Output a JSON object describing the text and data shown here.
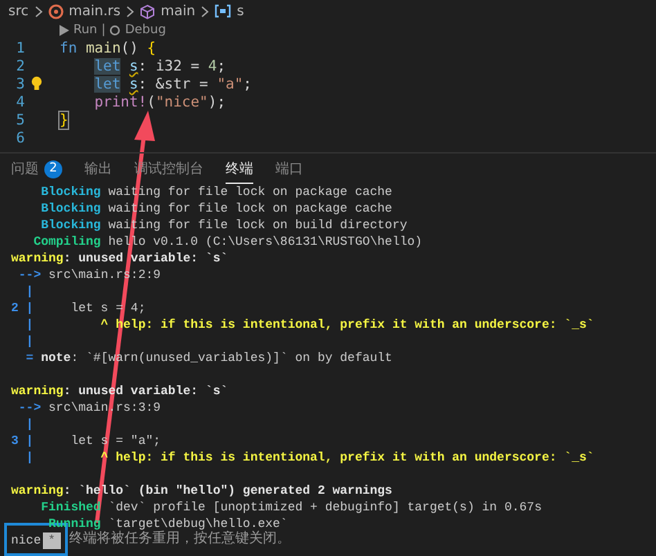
{
  "breadcrumb": [
    {
      "text": "src",
      "kind": "folder"
    },
    {
      "text": "main.rs",
      "kind": "file"
    },
    {
      "text": "main",
      "kind": "function"
    },
    {
      "text": "s",
      "kind": "variable"
    }
  ],
  "codelens": [
    {
      "text": "Run",
      "kind": "run"
    },
    {
      "text": "|",
      "kind": "separator"
    },
    {
      "text": "Debug",
      "kind": "debug"
    }
  ],
  "editor": {
    "lines": [
      {
        "number": "1",
        "tokens": [
          {
            "text": "fn",
            "kind": "keyword"
          },
          {
            "text": " main",
            "kind": "function"
          },
          {
            "text": "() ",
            "kind": "plain"
          },
          {
            "text": "{",
            "kind": "bracket"
          }
        ]
      },
      {
        "number": "2",
        "tokens": [
          {
            "kind": "indent"
          },
          {
            "text": "let",
            "kind": "keyword-match"
          },
          {
            "text": "s",
            "kind": "variable-warn"
          },
          {
            "text": ": ",
            "kind": "plain"
          },
          {
            "text": "i32",
            "kind": "type"
          },
          {
            "text": " = ",
            "kind": "plain"
          },
          {
            "text": "4",
            "kind": "number"
          },
          {
            "text": ";",
            "kind": "plain"
          }
        ]
      },
      {
        "number": "3",
        "lightbulb": true,
        "tokens": [
          {
            "kind": "indent"
          },
          {
            "text": "let",
            "kind": "keyword-match"
          },
          {
            "text": "s",
            "kind": "variable-warn"
          },
          {
            "text": ": &",
            "kind": "plain"
          },
          {
            "text": "str",
            "kind": "type"
          },
          {
            "text": " = ",
            "kind": "plain"
          },
          {
            "text": "\"a\"",
            "kind": "string"
          },
          {
            "text": ";",
            "kind": "plain"
          }
        ]
      },
      {
        "number": "4",
        "tokens": [
          {
            "kind": "indent"
          },
          {
            "text": "print!",
            "kind": "macro"
          },
          {
            "text": "(",
            "kind": "plain"
          },
          {
            "text": "\"nice\"",
            "kind": "string"
          },
          {
            "text": ");",
            "kind": "plain"
          }
        ]
      },
      {
        "number": "5",
        "tokens": [
          {
            "text": "}",
            "kind": "bracket-match"
          }
        ]
      },
      {
        "number": "6"
      }
    ]
  },
  "panel_tabs": [
    {
      "label": "问题",
      "badge": "2",
      "selected": false
    },
    {
      "label": "输出",
      "selected": false
    },
    {
      "label": "调试控制台",
      "selected": false
    },
    {
      "label": "终端",
      "selected": true
    },
    {
      "label": "端口",
      "selected": false
    }
  ],
  "terminal": {
    "lines": [
      {
        "segments": [
          {
            "text": "    Blocking",
            "kind": "status"
          },
          {
            "text": " waiting for file lock on package cache",
            "kind": "plain"
          }
        ]
      },
      {
        "segments": [
          {
            "text": "    Blocking",
            "kind": "status"
          },
          {
            "text": " waiting for file lock on package cache",
            "kind": "plain"
          }
        ]
      },
      {
        "segments": [
          {
            "text": "    Blocking",
            "kind": "status"
          },
          {
            "text": " waiting for file lock on build directory",
            "kind": "plain"
          }
        ]
      },
      {
        "segments": [
          {
            "text": "   Compiling",
            "kind": "done"
          },
          {
            "text": " hello v0.1.0 (C:\\Users\\86131\\RUSTGO\\hello)",
            "kind": "plain"
          }
        ]
      },
      {
        "segments": [
          {
            "text": "warning",
            "kind": "warning"
          },
          {
            "text": ": unused variable: `s`",
            "kind": "bold"
          }
        ]
      },
      {
        "segments": [
          {
            "text": " --> ",
            "kind": "gutter"
          },
          {
            "text": "src\\main.rs:2:9",
            "kind": "plain"
          }
        ]
      },
      {
        "segments": [
          {
            "text": "  |",
            "kind": "gutter"
          }
        ]
      },
      {
        "segments": [
          {
            "text": "2 |",
            "kind": "gutter"
          },
          {
            "text": "     let s = 4;",
            "kind": "plain"
          }
        ]
      },
      {
        "segments": [
          {
            "text": "  |",
            "kind": "gutter"
          },
          {
            "text": "         ^ help: if this is intentional, prefix it with an underscore: `_s`",
            "kind": "help"
          }
        ]
      },
      {
        "segments": [
          {
            "text": "  |",
            "kind": "gutter"
          }
        ]
      },
      {
        "segments": [
          {
            "text": "  = ",
            "kind": "gutter"
          },
          {
            "text": "note",
            "kind": "bold"
          },
          {
            "text": ": `#[warn(unused_variables)]` on by default",
            "kind": "plain"
          }
        ]
      },
      {
        "space_before": true,
        "segments": [
          {
            "text": "warning",
            "kind": "warning"
          },
          {
            "text": ": unused variable: `s`",
            "kind": "bold"
          }
        ]
      },
      {
        "segments": [
          {
            "text": " --> ",
            "kind": "gutter"
          },
          {
            "text": "src\\main.rs:3:9",
            "kind": "plain"
          }
        ]
      },
      {
        "segments": [
          {
            "text": "  |",
            "kind": "gutter"
          }
        ]
      },
      {
        "segments": [
          {
            "text": "3 |",
            "kind": "gutter"
          },
          {
            "text": "     let s = \"a\";",
            "kind": "plain"
          }
        ]
      },
      {
        "segments": [
          {
            "text": "  |",
            "kind": "gutter"
          },
          {
            "text": "         ^ help: if this is intentional, prefix it with an underscore: `_s`",
            "kind": "help"
          }
        ]
      },
      {
        "space_before": true,
        "segments": [
          {
            "text": "warning",
            "kind": "warning"
          },
          {
            "text": ": `hello` (bin \"hello\") generated 2 warnings",
            "kind": "bold"
          }
        ]
      },
      {
        "segments": [
          {
            "text": "    Finished",
            "kind": "done"
          },
          {
            "text": " `dev` profile [unoptimized + debuginfo] target(s) in 0.67s",
            "kind": "plain"
          }
        ]
      },
      {
        "segments": [
          {
            "text": "     Running",
            "kind": "done"
          },
          {
            "text": " `target\\debug\\hello.exe`",
            "kind": "plain"
          }
        ]
      },
      {
        "segments": [
          {
            "text": "nice",
            "kind": "plain"
          },
          {
            "text": "*",
            "kind": "cursor"
          },
          {
            "text": " 终端将被任务重用，按任意键关闭。",
            "kind": "dim"
          }
        ]
      }
    ]
  }
}
